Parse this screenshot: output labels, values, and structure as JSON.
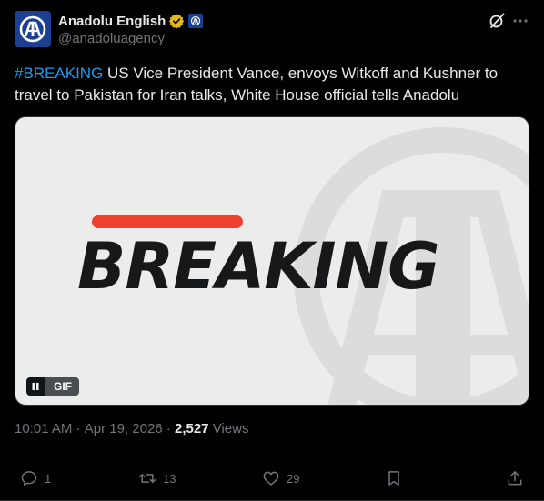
{
  "author": {
    "display_name": "Anadolu English",
    "handle": "@anadoluagency",
    "avatar_icon": "anadolu-logo-icon",
    "verified_color": "#e2b719",
    "brand_color": "#1b3f91"
  },
  "tweet": {
    "hashtag": "#BREAKING",
    "text": " US Vice President Vance, envoys Witkoff and Kushner to travel to Pakistan for Iran talks, White House official tells Anadolu"
  },
  "media": {
    "headline": "BREAKING",
    "accent_color": "#f0412f",
    "gif_label": "GIF"
  },
  "meta": {
    "time": "10:01 AM",
    "separator": " · ",
    "date": "Apr 19, 2026",
    "separator2": " · ",
    "views_count": "2,527",
    "views_label": " Views"
  },
  "actions": {
    "replies": "1",
    "reposts": "13",
    "likes": "29"
  },
  "colors": {
    "link": "#1d9bf0",
    "muted": "#71767b",
    "text": "#e7e9ea"
  }
}
